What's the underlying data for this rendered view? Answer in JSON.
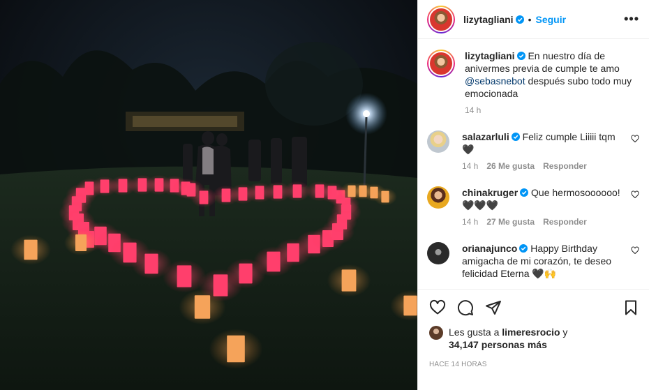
{
  "post": {
    "author": "lizytagliani",
    "follow_label": "Seguir",
    "separator": "•",
    "more_label": "•••"
  },
  "caption": {
    "author": "lizytagliani",
    "text_1": "En nuestro día de anivermes previa de cumple te amo",
    "mention": "@sebasnebot",
    "text_2": " después subo todo muy emocionada",
    "time": "14 h"
  },
  "comments": [
    {
      "author": "salazarluli",
      "text": "Feliz cumple Liiiii tqm 🖤",
      "time": "14 h",
      "likes": "26 Me gusta",
      "reply": "Responder"
    },
    {
      "author": "chinakruger",
      "text": "Que hermosoooooo! 🖤🖤🖤",
      "time": "14 h",
      "likes": "27 Me gusta",
      "reply": "Responder"
    },
    {
      "author": "orianajunco",
      "text": "Happy Birthday amigacha de mi corazón, te deseo felicidad Eterna 🖤🙌",
      "time": "",
      "likes": "",
      "reply": ""
    }
  ],
  "likes": {
    "prefix": "Les gusta a ",
    "user": "limeresrocio",
    "conj": " y",
    "count": "34,147 personas más"
  },
  "timestamp": "HACE 14 HORAS",
  "colors": {
    "accent": "#0095f6",
    "text": "#262626",
    "muted": "#8e8e8e",
    "mention": "#00376b"
  }
}
